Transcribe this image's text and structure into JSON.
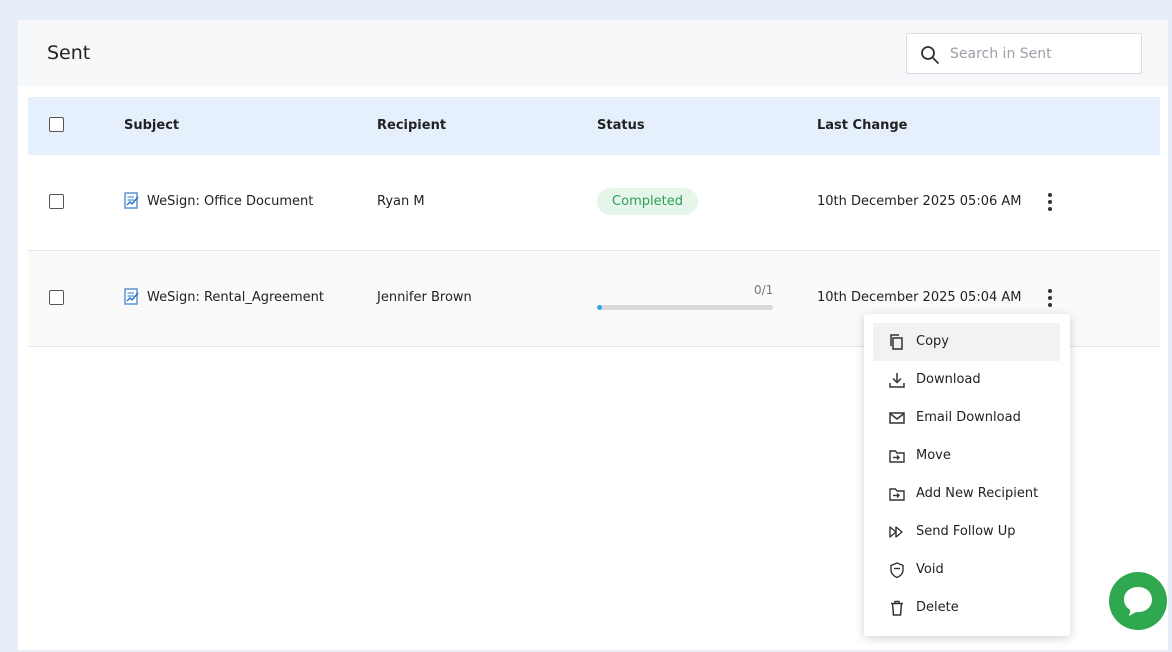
{
  "header": {
    "title": "Sent",
    "search_placeholder": "Search in Sent",
    "search_value": ""
  },
  "table": {
    "columns": [
      "Subject",
      "Recipient",
      "Status",
      "Last Change"
    ],
    "rows": [
      {
        "subject": "WeSign: Office Document",
        "recipient": "Ryan M",
        "status": "Completed",
        "last_change": "10th December 2025 05:06 AM"
      },
      {
        "subject": "WeSign: Rental_Agreement",
        "recipient": "Jennifer Brown",
        "progress_label": "0/1",
        "progress_fraction": 0.03,
        "last_change": "10th December 2025 05:04 AM"
      }
    ]
  },
  "context_menu": {
    "items": [
      {
        "label": "Copy",
        "icon": "copy-icon"
      },
      {
        "label": "Download",
        "icon": "download-icon"
      },
      {
        "label": "Email Download",
        "icon": "mail-icon"
      },
      {
        "label": "Move",
        "icon": "move-icon"
      },
      {
        "label": "Add New Recipient",
        "icon": "add-recipient-icon"
      },
      {
        "label": "Send Follow Up",
        "icon": "fast-forward-icon"
      },
      {
        "label": "Void",
        "icon": "shield-icon"
      },
      {
        "label": "Delete",
        "icon": "trash-icon"
      }
    ]
  },
  "colors": {
    "header_bg": "#e6f0fd",
    "completed_bg": "#e6f5ea",
    "completed_text": "#2f9e55",
    "progress_fill": "#2aa8e8",
    "chat_button": "#2fa84f"
  }
}
